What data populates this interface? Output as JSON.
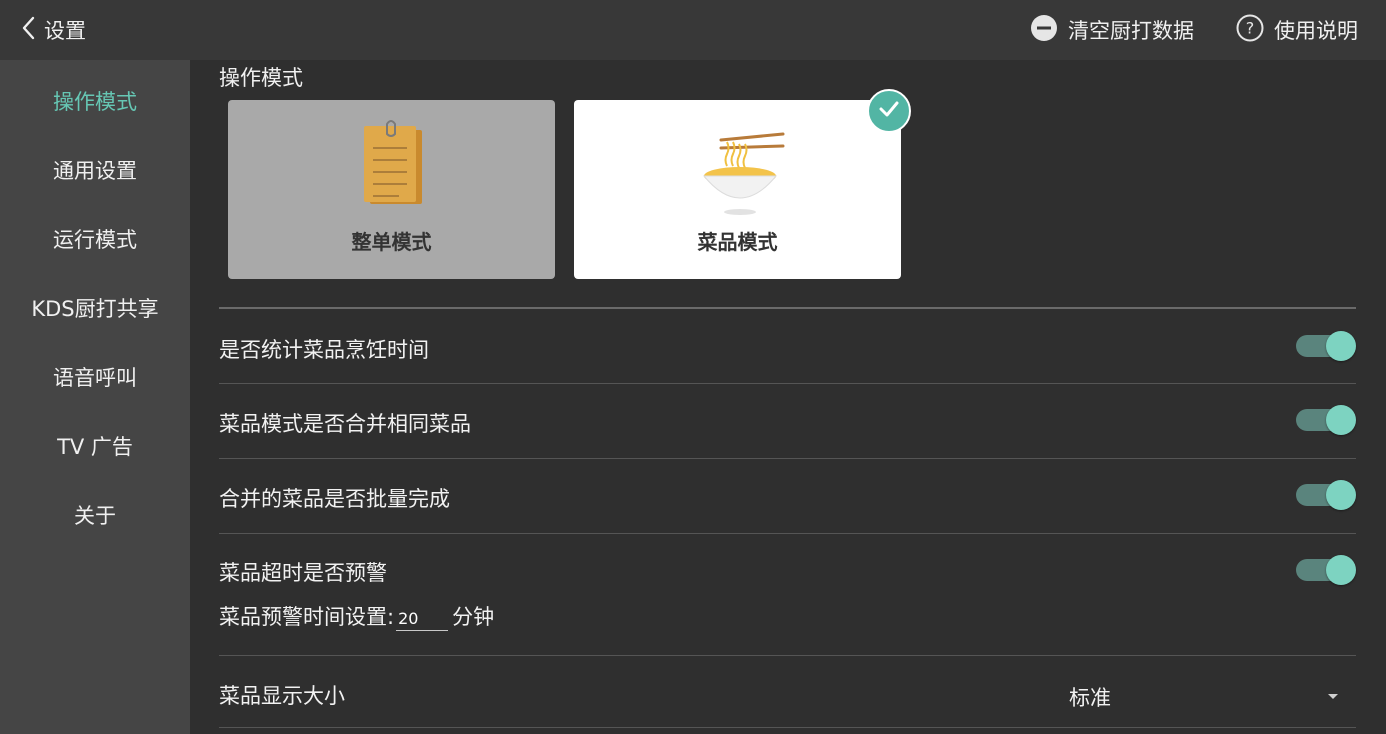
{
  "topbar": {
    "back_label": "设置",
    "clear_label": "清空厨打数据",
    "help_label": "使用说明"
  },
  "sidebar": {
    "items": [
      {
        "label": "操作模式",
        "active": true
      },
      {
        "label": "通用设置",
        "active": false
      },
      {
        "label": "运行模式",
        "active": false
      },
      {
        "label": "KDS厨打共享",
        "active": false
      },
      {
        "label": "语音呼叫",
        "active": false
      },
      {
        "label": "TV 广告",
        "active": false
      },
      {
        "label": "关于",
        "active": false
      }
    ]
  },
  "main": {
    "section_title": "操作模式",
    "modes": [
      {
        "label": "整单模式",
        "icon": "notepad-icon",
        "selected": false
      },
      {
        "label": "菜品模式",
        "icon": "noodle-bowl-icon",
        "selected": true
      }
    ],
    "settings": [
      {
        "label": "是否统计菜品烹饪时间",
        "enabled": true
      },
      {
        "label": "菜品模式是否合并相同菜品",
        "enabled": true
      },
      {
        "label": "合并的菜品是否批量完成",
        "enabled": true
      },
      {
        "label": "菜品超时是否预警",
        "enabled": true
      }
    ],
    "warn_time_label": "菜品预警时间设置:",
    "warn_time_value": "20",
    "warn_time_unit": "分钟",
    "display_size_label": "菜品显示大小",
    "display_size_value": "标准"
  },
  "colors": {
    "accent": "#66c7b4",
    "toggle_thumb": "#7dd3c1",
    "toggle_track": "#5a847d",
    "background": "#2f2f2f",
    "sidebar": "#454545",
    "topbar": "#383838"
  }
}
